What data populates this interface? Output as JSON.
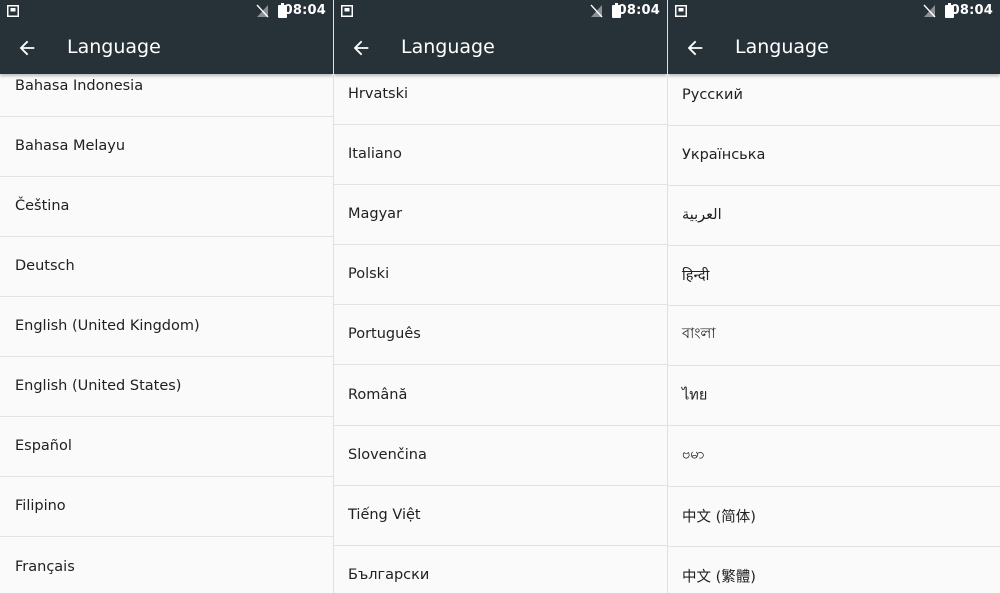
{
  "status_bar": {
    "time": "08:04"
  },
  "toolbar": {
    "title": "Language"
  },
  "screens": [
    {
      "languages": [
        "Bahasa Indonesia",
        "Bahasa Melayu",
        "Čeština",
        "Deutsch",
        "English (United Kingdom)",
        "English (United States)",
        "Español",
        "Filipino",
        "Français"
      ]
    },
    {
      "languages": [
        "Hrvatski",
        "Italiano",
        "Magyar",
        "Polski",
        "Português",
        "Română",
        "Slovenčina",
        "Tiếng Việt",
        "Български"
      ]
    },
    {
      "languages": [
        "Русский",
        "Українська",
        "العربية",
        "हिन्दी",
        "বাংলা",
        "ไทย",
        "ဗမာ",
        "中文 (简体)",
        "中文 (繁體)"
      ]
    }
  ],
  "colors": {
    "toolbar": "#263238",
    "background": "#fafafa",
    "divider": "#e3e3e3",
    "text": "#212121"
  },
  "icons": {
    "notification": "notification-icon",
    "signal": "no-sim-signal-icon",
    "battery": "battery-icon",
    "back": "back-arrow-icon"
  }
}
